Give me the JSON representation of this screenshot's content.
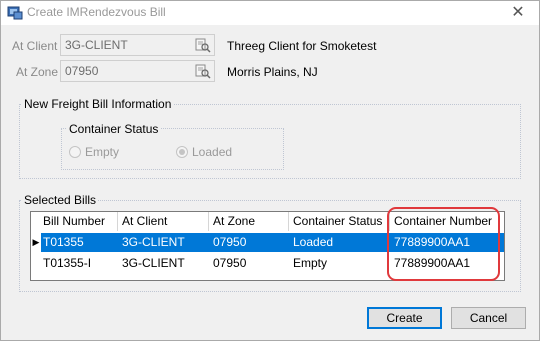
{
  "window": {
    "title": "Create IMRendezvous Bill",
    "close_glyph": "✕"
  },
  "at_client": {
    "label": "At Client",
    "value": "3G-CLIENT",
    "description": "Threeg Client for Smoketest"
  },
  "at_zone": {
    "label": "At Zone",
    "value": "07950",
    "description": "Morris Plains, NJ"
  },
  "freight_info": {
    "legend": "New Freight Bill Information",
    "container_status": {
      "legend": "Container Status",
      "options": [
        {
          "label": "Empty",
          "checked": false
        },
        {
          "label": "Loaded",
          "checked": true
        }
      ]
    }
  },
  "selected_bills": {
    "legend": "Selected Bills",
    "columns": [
      "Bill Number",
      "At Client",
      "At Zone",
      "Container Status",
      "Container Number"
    ],
    "rows": [
      {
        "bill_number": "T01355",
        "at_client": "3G-CLIENT",
        "at_zone": "07950",
        "container_status": "Loaded",
        "container_number": "77889900AA1",
        "selected": true
      },
      {
        "bill_number": "T01355-I",
        "at_client": "3G-CLIENT",
        "at_zone": "07950",
        "container_status": "Empty",
        "container_number": "77889900AA1",
        "selected": false
      }
    ]
  },
  "buttons": {
    "create": "Create",
    "cancel": "Cancel"
  },
  "colors": {
    "selection": "#0078d7",
    "highlight_outline": "#e0393c"
  }
}
